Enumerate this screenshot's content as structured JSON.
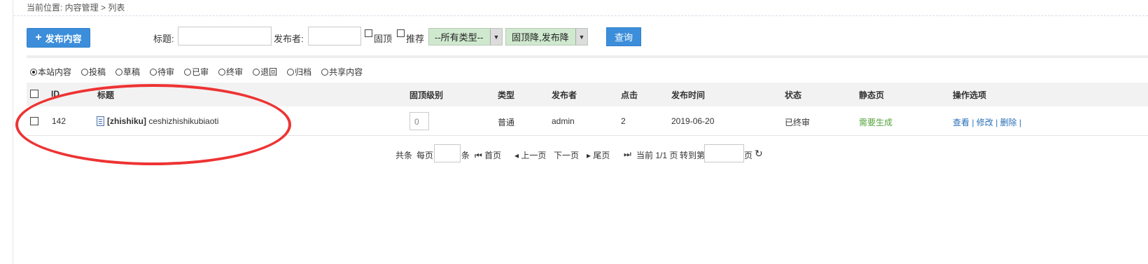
{
  "breadcrumb": "当前位置: 内容管理 > 列表",
  "toolbar": {
    "publish_plus": "+",
    "publish_label": "发布内容",
    "title_label": "标题:",
    "title_value": "",
    "publisher_label": "发布者:",
    "publisher_value": "",
    "top_label": "固顶",
    "recommend_label": "推荐",
    "type_select": "--所有类型--",
    "sort_select": "固顶降,发布降",
    "query_label": "查询"
  },
  "filters": [
    {
      "label": "本站内容",
      "selected": true
    },
    {
      "label": "投稿",
      "selected": false
    },
    {
      "label": "草稿",
      "selected": false
    },
    {
      "label": "待审",
      "selected": false
    },
    {
      "label": "已审",
      "selected": false
    },
    {
      "label": "终审",
      "selected": false
    },
    {
      "label": "退回",
      "selected": false
    },
    {
      "label": "归档",
      "selected": false
    },
    {
      "label": "共享内容",
      "selected": false
    }
  ],
  "table": {
    "headers": {
      "id": "ID",
      "title": "标题",
      "top_level": "固顶级别",
      "type": "类型",
      "publisher": "发布者",
      "clicks": "点击",
      "publish_time": "发布时间",
      "status": "状态",
      "static_page": "静态页",
      "actions": "操作选项"
    },
    "rows": [
      {
        "id": "142",
        "title_prefix": "[zhishiku]",
        "title": "ceshizhishikubiaoti",
        "top_level": "0",
        "type": "普通",
        "publisher": "admin",
        "clicks": "2",
        "publish_time": "2019-06-20",
        "status": "已终审",
        "static_page": "需要生成",
        "action_view": "查看",
        "action_edit": "修改",
        "action_delete": "删除",
        "sep": "|"
      }
    ]
  },
  "pager": {
    "total": "共条",
    "per_page": "每页",
    "per_page_value": "",
    "unit": "条",
    "first": "首页",
    "prev": "上一页",
    "next": "下一页",
    "last": "尾页",
    "current": "当前 1/1 页",
    "goto": "转到第",
    "goto_value": "",
    "page_unit": "页"
  },
  "colors": {
    "primary": "#3c8edb",
    "select_bg": "#cfe9cf",
    "link": "#2a6fb8",
    "status_green": "#53a33c",
    "annotation_red": "#ee3333"
  }
}
